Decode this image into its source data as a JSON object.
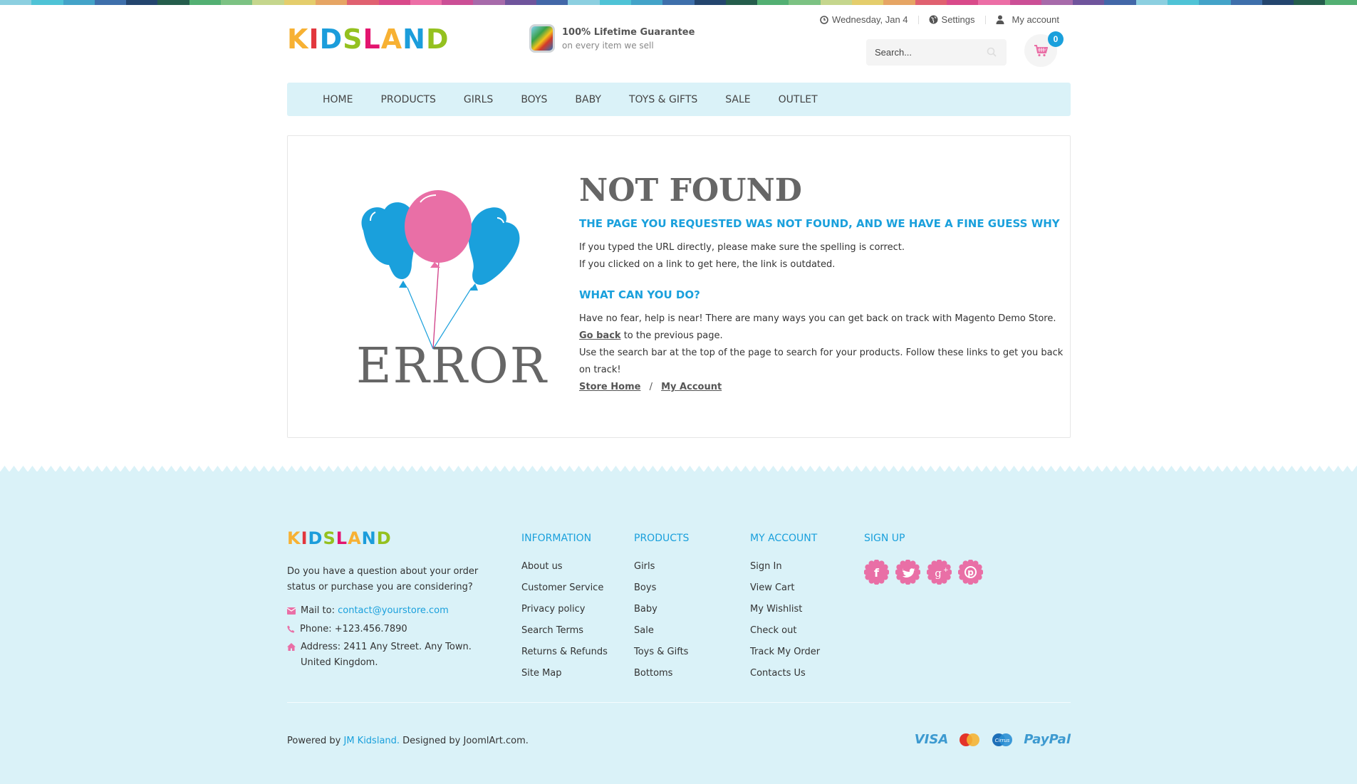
{
  "colors": {
    "accent_blue": "#1aa0dc",
    "pink": "#e96fa6",
    "nav_bg": "#daf2f8",
    "footer_bg": "#daf2f8",
    "text_dark": "#333333",
    "title_gray": "#666666",
    "stripe": [
      "#8ccfe0",
      "#4fc3d6",
      "#43a3c8",
      "#3e6fab",
      "#24456e",
      "#255d4c",
      "#53b073",
      "#7cc283",
      "#c5d68d",
      "#e4cd6c",
      "#e6a564",
      "#e06170",
      "#d94a8a",
      "#ec6ea6",
      "#cb4f96",
      "#a76aaa",
      "#6f549c",
      "#4267a8",
      "#8ccfe0",
      "#4fc3d6",
      "#43a3c8",
      "#3e6fab",
      "#24456e",
      "#255d4c",
      "#53b073",
      "#7cc283",
      "#c5d68d",
      "#e4cd6c",
      "#e6a564",
      "#e06170",
      "#d94a8a",
      "#ec6ea6",
      "#cb4f96",
      "#a76aaa",
      "#6f549c",
      "#4267a8",
      "#8ccfe0",
      "#4fc3d6",
      "#43a3c8",
      "#3e6fab",
      "#24456e",
      "#255d4c",
      "#53b073"
    ]
  },
  "header": {
    "logo": {
      "letters": [
        {
          "ch": "K",
          "color": "#f7b133"
        },
        {
          "ch": "I",
          "color": "#e2373d"
        },
        {
          "ch": "D",
          "color": "#1b9ddb"
        },
        {
          "ch": "S",
          "color": "#94c11f"
        },
        {
          "ch": "L",
          "color": "#e3156f"
        },
        {
          "ch": "A",
          "color": "#f7b133"
        },
        {
          "ch": "N",
          "color": "#1b9ddb"
        },
        {
          "ch": "D",
          "color": "#94c11f"
        }
      ]
    },
    "guarantee": {
      "title": "100% Lifetime Guarantee",
      "subtitle": "on every item we sell",
      "icon": "toy-product-icon"
    },
    "top_links": {
      "date": "Wednesday, Jan 4",
      "settings": "Settings",
      "account": "My account"
    },
    "search": {
      "placeholder": "Search...",
      "value": ""
    },
    "cart": {
      "count": "0"
    }
  },
  "nav": {
    "items": [
      {
        "label": "HOME"
      },
      {
        "label": "PRODUCTS"
      },
      {
        "label": "GIRLS"
      },
      {
        "label": "BOYS"
      },
      {
        "label": "BABY"
      },
      {
        "label": "TOYS & GIFTS"
      },
      {
        "label": "SALE"
      },
      {
        "label": "OUTLET"
      }
    ]
  },
  "main": {
    "error_image_text": "ERROR",
    "title": "NOT FOUND",
    "subtitle": "THE PAGE YOU REQUESTED WAS NOT FOUND, AND WE HAVE A FINE GUESS WHY",
    "reasons": [
      "If you typed the URL directly, please make sure the spelling is correct.",
      "If you clicked on a link to get here, the link is outdated."
    ],
    "what_heading": "WHAT CAN YOU DO?",
    "help_line": "Have no fear, help is near! There are many ways you can get back on track with Magento Demo Store.",
    "go_back_link": "Go back",
    "go_back_rest": " to the previous page.",
    "search_line_1": "Use the search bar at the top of the page to search for your products. Follow these links to get you back",
    "search_line_2": "on track!",
    "store_home_link": "Store Home",
    "link_separator": "/",
    "my_account_link": "My Account"
  },
  "footer": {
    "about": "Do you have a question about your order status or purchase you are considering?",
    "mail_label": "Mail to: ",
    "mail_value": "contact@yourstore.com",
    "phone": "Phone: +123.456.7890",
    "address": "Address: 2411 Any Street. Any Town. United Kingdom.",
    "columns": [
      {
        "heading": "INFORMATION",
        "links": [
          "About us",
          "Customer Service",
          "Privacy policy",
          "Search Terms",
          "Returns & Refunds",
          "Site Map"
        ]
      },
      {
        "heading": "PRODUCTS",
        "links": [
          "Girls",
          "Boys",
          "Baby",
          "Sale",
          "Toys & Gifts",
          "Bottoms"
        ]
      },
      {
        "heading": "MY ACCOUNT",
        "links": [
          "Sign In",
          "View Cart",
          "My Wishlist",
          "Check out",
          "Track My Order",
          "Contacts Us"
        ]
      }
    ],
    "signup_heading": "SIGN UP",
    "social": [
      {
        "name": "facebook",
        "glyph": "f"
      },
      {
        "name": "twitter",
        "glyph": "t"
      },
      {
        "name": "google-plus",
        "glyph": "g+"
      },
      {
        "name": "pinterest",
        "glyph": "p"
      }
    ],
    "powered_prefix": "Powered by ",
    "powered_link": "JM Kidsland.",
    "powered_suffix": " Designed by JoomlArt.com.",
    "payments": {
      "visa": "VISA",
      "mastercard": "MasterCard",
      "cirrus": "Cirrus",
      "paypal": "PayPal"
    }
  }
}
